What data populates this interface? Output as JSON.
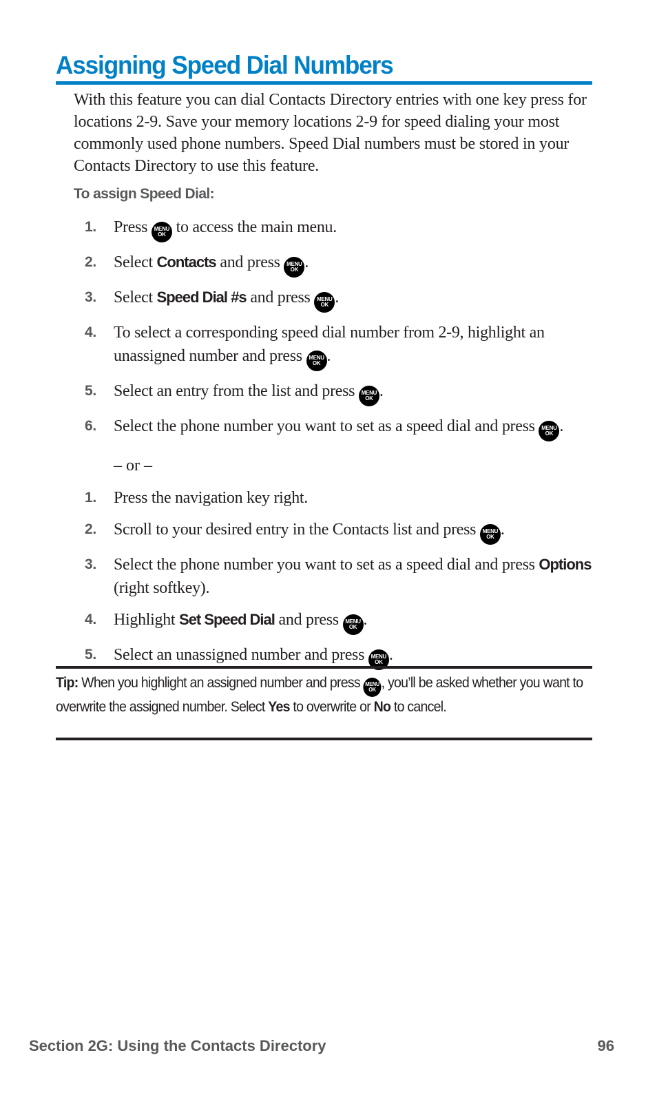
{
  "page": {
    "title": "Assigning Speed Dial Numbers",
    "intro": "With this feature you can dial Contacts Directory entries with one key press for locations 2-9. Save your memory locations 2-9 for speed dialing your most commonly used phone numbers. Speed Dial numbers must be stored in your Contacts Directory to use this feature.",
    "subhead": "To assign Speed Dial:",
    "menu_key": {
      "line1": "MENU",
      "line2": "OK",
      "icon": "menu-ok-key-icon"
    },
    "steps_a": [
      {
        "num": "1.",
        "pre": "Press ",
        "bold": "",
        "mid": "",
        "post": " to access the main menu."
      },
      {
        "num": "2.",
        "pre": "Select ",
        "bold": "Contacts",
        "mid": " and press ",
        "post": "."
      },
      {
        "num": "3.",
        "pre": "Select ",
        "bold": "Speed Dial #s",
        "mid": " and press ",
        "post": "."
      },
      {
        "num": "4.",
        "pre": "To select a corresponding speed dial number from 2-9, highlight an unassigned number and press ",
        "bold": "",
        "mid": "",
        "post": "."
      },
      {
        "num": "5.",
        "pre": "Select an entry from the list and press ",
        "bold": "",
        "mid": "",
        "post": "."
      },
      {
        "num": "6.",
        "pre": "Select the phone number you want to set as a speed dial and press ",
        "bold": "",
        "mid": "",
        "post": "."
      }
    ],
    "or_text": "– or –",
    "steps_b": [
      {
        "num": "1.",
        "text": "Press the navigation key right."
      },
      {
        "num": "2.",
        "pre": "Scroll to your desired entry in the Contacts list and press ",
        "post": "."
      },
      {
        "num": "3.",
        "pre": "Select the phone number you want to set as a speed dial and press ",
        "bold": "Options",
        "post": " (right softkey)."
      },
      {
        "num": "4.",
        "pre": "Highlight ",
        "bold": "Set Speed Dial",
        "mid": " and press ",
        "post": "."
      },
      {
        "num": "5.",
        "pre": "Select an unassigned number and press ",
        "post": "."
      }
    ],
    "tip": {
      "label": "Tip:",
      "pre": " When you highlight an assigned number and press ",
      "mid": ", you’ll be asked whether you want to overwrite the assigned number. Select ",
      "yes": "Yes",
      "mid2": " to overwrite or ",
      "no": "No",
      "post": " to cancel."
    },
    "footer": {
      "section": "Section 2G: Using the Contacts Directory",
      "page_number": "96"
    }
  }
}
